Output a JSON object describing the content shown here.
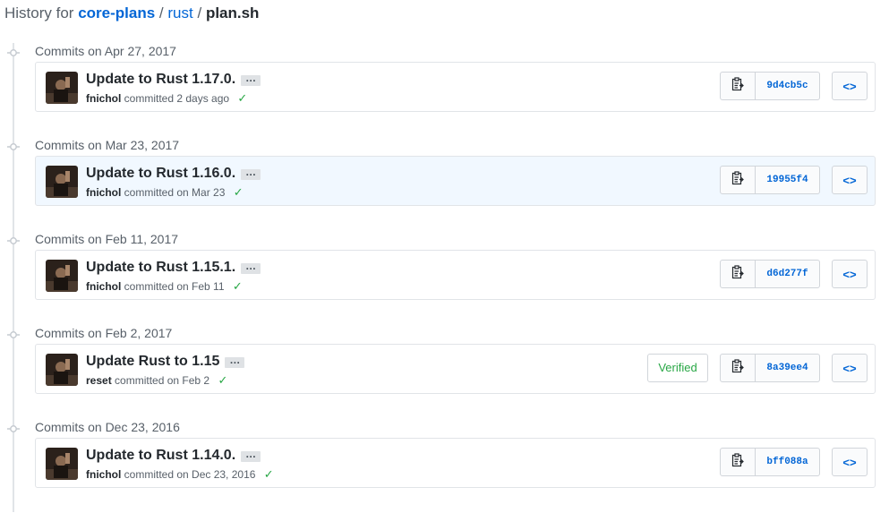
{
  "breadcrumb": {
    "prefix": "History for",
    "repo": "core-plans",
    "sep1": "/",
    "dir": "rust",
    "sep2": "/",
    "file": "plan.sh"
  },
  "groups": [
    {
      "title": "Commits on Apr 27, 2017",
      "commit": {
        "message": "Update to Rust 1.17.0.",
        "author": "fnichol",
        "action": "committed 2 days ago",
        "sha": "9d4cb5c",
        "verified": "",
        "highlighted": false
      }
    },
    {
      "title": "Commits on Mar 23, 2017",
      "commit": {
        "message": "Update to Rust 1.16.0.",
        "author": "fnichol",
        "action": "committed on Mar 23",
        "sha": "19955f4",
        "verified": "",
        "highlighted": true
      }
    },
    {
      "title": "Commits on Feb 11, 2017",
      "commit": {
        "message": "Update to Rust 1.15.1.",
        "author": "fnichol",
        "action": "committed on Feb 11",
        "sha": "d6d277f",
        "verified": "",
        "highlighted": false
      }
    },
    {
      "title": "Commits on Feb 2, 2017",
      "commit": {
        "message": "Update Rust to 1.15",
        "author": "reset",
        "action": "committed on Feb 2",
        "sha": "8a39ee4",
        "verified": "Verified",
        "highlighted": false
      }
    },
    {
      "title": "Commits on Dec 23, 2016",
      "commit": {
        "message": "Update to Rust 1.14.0.",
        "author": "fnichol",
        "action": "committed on Dec 23, 2016",
        "sha": "bff088a",
        "verified": "",
        "highlighted": false
      }
    }
  ],
  "labels": {
    "ellipsis": "…",
    "check": "✓",
    "browse": "<>"
  },
  "colors": {
    "link": "#0366d6",
    "success": "#28a745",
    "highlight": "#f1f8ff"
  }
}
